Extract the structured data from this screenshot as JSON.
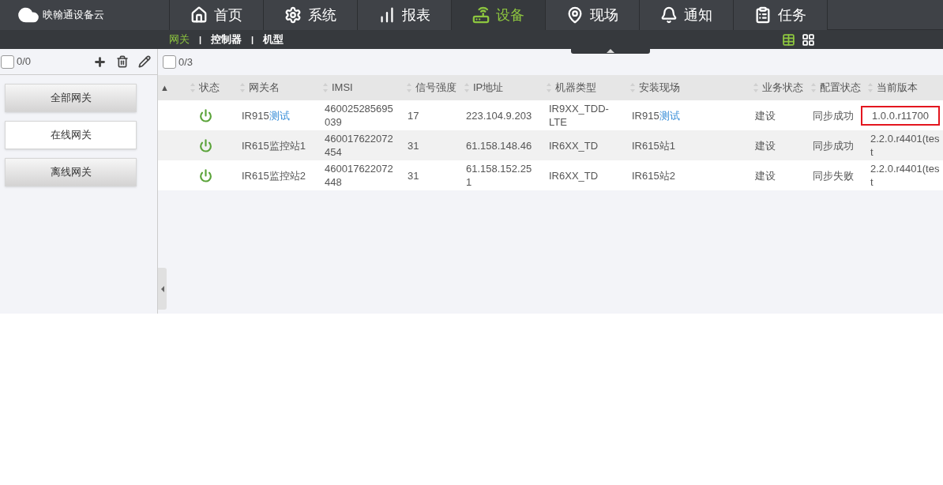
{
  "brand": "映翰通设备云",
  "nav": [
    {
      "label": "首页",
      "selected": false
    },
    {
      "label": "系统",
      "selected": false
    },
    {
      "label": "报表",
      "selected": false
    },
    {
      "label": "设备",
      "selected": true
    },
    {
      "label": "现场",
      "selected": false
    },
    {
      "label": "通知",
      "selected": false
    },
    {
      "label": "任务",
      "selected": false
    }
  ],
  "subnav": {
    "separator": "|",
    "items": [
      {
        "label": "网关",
        "selected": true
      },
      {
        "label": "控制器",
        "selected": false
      },
      {
        "label": "机型",
        "selected": false
      }
    ]
  },
  "view_toggle": [
    {
      "selected": true
    },
    {
      "selected": false
    }
  ],
  "sidebar": {
    "count": "0/0",
    "checked": false,
    "items": [
      {
        "label": "全部网关",
        "selected": false
      },
      {
        "label": "在线网关",
        "selected": true
      },
      {
        "label": "离线网关",
        "selected": false
      }
    ]
  },
  "table": {
    "count": "0/3",
    "checked": false,
    "sort_mark": "▲",
    "columns": [
      "状态",
      "网关名",
      "IMSI",
      "信号强度",
      "IP地址",
      "机器类型",
      "安装现场",
      "业务状态",
      "配置状态",
      "当前版本"
    ],
    "rows": [
      {
        "online": true,
        "name": [
          {
            "text": "IR915",
            "kind": "plain"
          },
          {
            "text": "测试",
            "kind": "link"
          }
        ],
        "imsi": "460025285695039",
        "signal": "17",
        "ip": "223.104.9.203",
        "model": "IR9XX_TDD-LTE",
        "site": [
          {
            "text": "IR915",
            "kind": "plain"
          },
          {
            "text": "测试",
            "kind": "link"
          }
        ],
        "business": "建设",
        "config": "同步成功",
        "version": "1.0.0.r11700",
        "flagged": true
      },
      {
        "online": true,
        "name": [
          {
            "text": "IR615监控站1",
            "kind": "plain"
          }
        ],
        "imsi": "460017622072454",
        "signal": "31",
        "ip": "61.158.148.46",
        "model": "IR6XX_TD",
        "site": [
          {
            "text": "IR615站1",
            "kind": "plain"
          }
        ],
        "business": "建设",
        "config": "同步成功",
        "version": "2.2.0.r4401(test",
        "flagged": false
      },
      {
        "online": true,
        "name": [
          {
            "text": "IR615监控站2",
            "kind": "plain"
          }
        ],
        "imsi": "460017622072448",
        "signal": "31",
        "ip": "61.158.152.251",
        "model": "IR6XX_TD",
        "site": [
          {
            "text": "IR615站2",
            "kind": "plain"
          }
        ],
        "business": "建设",
        "config": "同步失败",
        "version": "2.2.0.r4401(test",
        "flagged": false
      }
    ]
  }
}
